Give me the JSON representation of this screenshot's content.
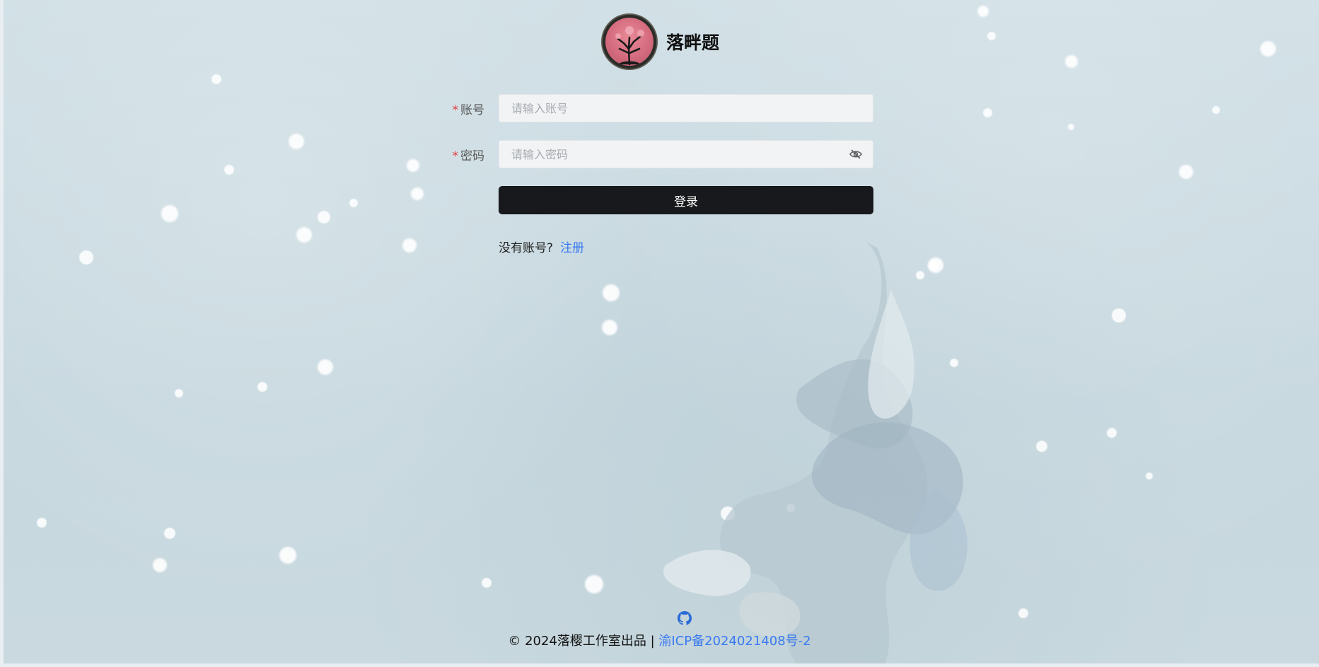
{
  "brand": {
    "name": "落畔题",
    "logo_icon": "sakura-tree-logo-icon"
  },
  "form": {
    "account": {
      "required_mark": "*",
      "label": "账号",
      "placeholder": "请输入账号",
      "value": ""
    },
    "password": {
      "required_mark": "*",
      "label": "密码",
      "placeholder": "请输入密码",
      "value": "",
      "toggle_icon": "eye-hidden-icon"
    },
    "login_label": "登录",
    "no_account_text": "没有账号?",
    "register_label": "注册"
  },
  "footer": {
    "github_icon": "github-icon",
    "copyright": "© 2024落樱工作室出品 |",
    "icp_link": "渝ICP备2024021408号-2"
  },
  "colors": {
    "background": "#ccdde4",
    "button": "#18191c",
    "link": "#3a7af0",
    "required": "#e23b3b"
  }
}
